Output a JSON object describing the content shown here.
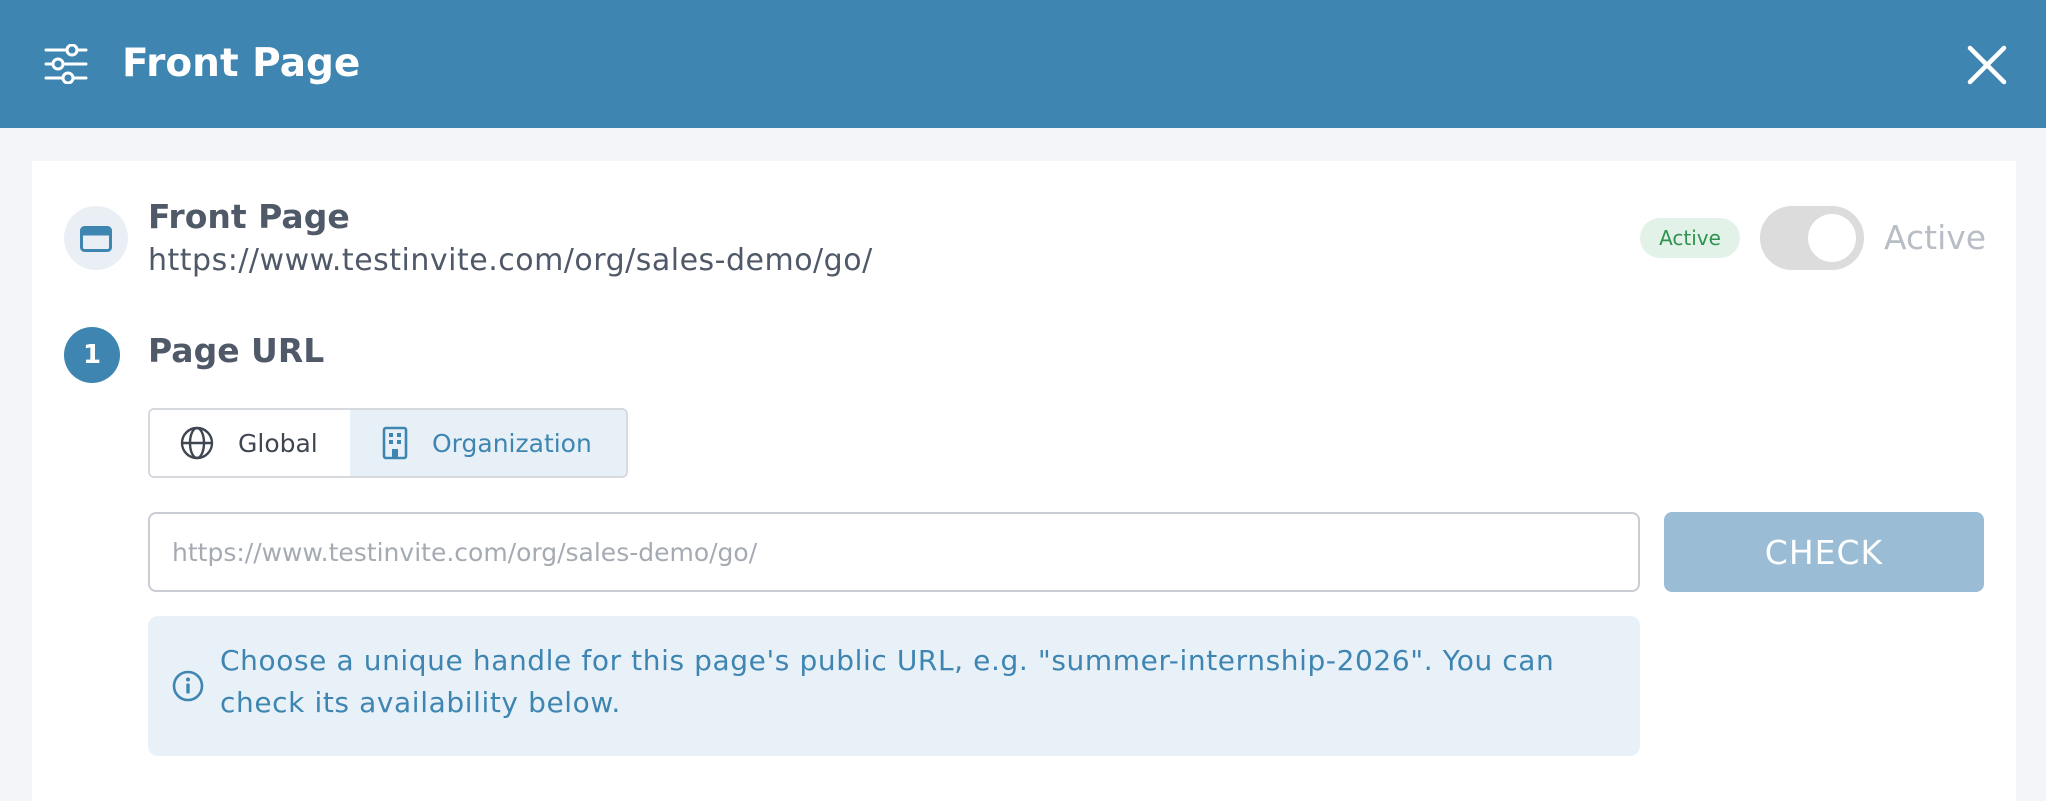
{
  "header": {
    "title": "Front Page"
  },
  "page": {
    "title": "Front Page",
    "url": "https://www.testinvite.com/org/sales-demo/go/",
    "status_badge": "Active",
    "toggle_label": "Active",
    "toggle_on": false
  },
  "section": {
    "step_number": "1",
    "title": "Page URL"
  },
  "scope_options": [
    {
      "label": "Global",
      "icon": "globe-icon",
      "selected": false
    },
    {
      "label": "Organization",
      "icon": "building-icon",
      "selected": true
    }
  ],
  "url_input": {
    "value": "",
    "placeholder": "https://www.testinvite.com/org/sales-demo/go/"
  },
  "check_button": {
    "label": "CHECK"
  },
  "info": {
    "text": "Choose a unique handle for this page's public URL, e.g. \"summer-internship-2026\". You can check its availability below."
  },
  "colors": {
    "header_bg": "#3e86b1",
    "accent": "#3e86b1",
    "badge_bg": "#e3f2e8",
    "badge_text": "#2e9350",
    "check_button_bg": "#9abdd5",
    "info_bg": "#e8f0f8"
  }
}
